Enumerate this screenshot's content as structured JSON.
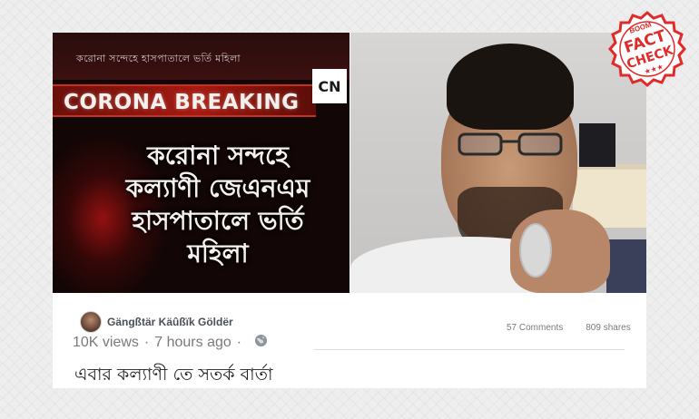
{
  "news_frame": {
    "ticker_top": "করোনা সন্দেহে হাসপাতালে ভর্তি মহিলা",
    "brand_label": "CORONA BREAKING",
    "channel_logo": "CN",
    "headline_lines": [
      "করোনা সন্দহে",
      "কল্যাণী জেএনএম",
      "হাসপাতালে ভর্তি",
      "মহিলা"
    ]
  },
  "badge": {
    "brand": "BOOM",
    "line1": "FACT",
    "line2": "CHECK",
    "stars": "★★★",
    "color": "#e02b2b"
  },
  "post": {
    "author": "Gängßtär Käûßïk Göldër",
    "views": "10K views",
    "separator": "·",
    "time": "7 hours ago",
    "separator2": "·",
    "privacy_icon": "globe-icon",
    "text": "এবার কল্যাণী তে সতর্ক বার্তা",
    "comments": "57 Comments",
    "shares": "809 shares"
  }
}
